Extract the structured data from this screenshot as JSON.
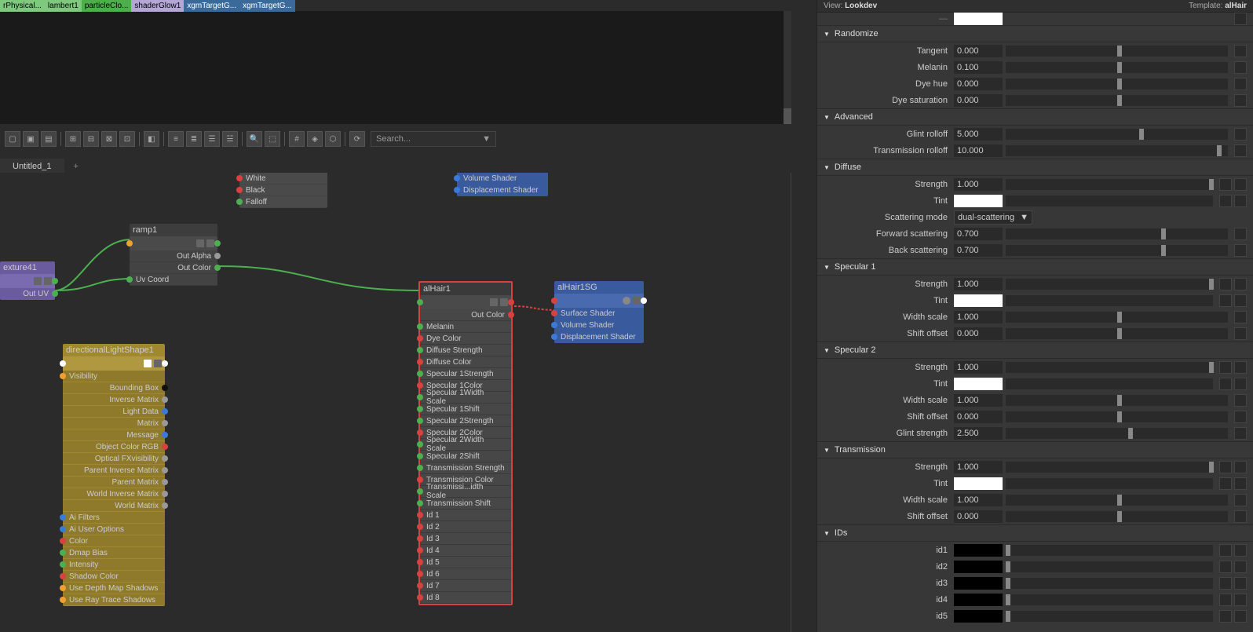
{
  "topTabs": [
    {
      "label": "rPhysical...",
      "cls": "tab-green-light"
    },
    {
      "label": "lambert1",
      "cls": "tab-green-light"
    },
    {
      "label": "particleClo...",
      "cls": "tab-green"
    },
    {
      "label": "shaderGlow1",
      "cls": "tab-purple"
    },
    {
      "label": "xgmTargetG...",
      "cls": "tab-dark"
    },
    {
      "label": "xgmTargetG...",
      "cls": "tab-dark"
    }
  ],
  "search": {
    "placeholder": "Search..."
  },
  "graphTab": "Untitled_1",
  "nodes": {
    "topRamp": {
      "rows": [
        "White",
        "Black",
        "Falloff"
      ]
    },
    "topShader": {
      "rows": [
        "Volume Shader",
        "Displacement Shader"
      ]
    },
    "ramp": {
      "title": "ramp1",
      "outAlpha": "Out Alpha",
      "outColor": "Out Color",
      "uvCoord": "Uv Coord"
    },
    "texture": {
      "title": "exture41",
      "outUV": "Out UV"
    },
    "light": {
      "title": "directionalLightShape1",
      "visibility": "Visibility",
      "rows": [
        "Bounding Box",
        "Inverse Matrix",
        "Light Data",
        "Matrix",
        "Message",
        "Object Color RGB",
        "Optical FXvisibility",
        "Parent Inverse Matrix",
        "Parent Matrix",
        "World Inverse Matrix",
        "World Matrix"
      ],
      "rows2": [
        "Ai Filters",
        "Ai User Options",
        "Color",
        "Dmap Bias",
        "Intensity",
        "Shadow Color",
        "Use Depth Map Shadows",
        "Use Ray Trace Shadows"
      ]
    },
    "alhair": {
      "title": "alHair1",
      "outColor": "Out Color",
      "rows": [
        "Melanin",
        "Dye Color",
        "Diffuse Strength",
        "Diffuse Color",
        "Specular 1Strength",
        "Specular 1Color",
        "Specular 1Width Scale",
        "Specular 1Shift",
        "Specular 2Strength",
        "Specular 2Color",
        "Specular 2Width Scale",
        "Specular 2Shift",
        "Transmission Strength",
        "Transmission Color",
        "Transmissi...idth Scale",
        "Transmission Shift",
        "Id 1",
        "Id 2",
        "Id 3",
        "Id 4",
        "Id 5",
        "Id 6",
        "Id 7",
        "Id 8"
      ]
    },
    "sg": {
      "title": "alHair1SG",
      "rows": [
        "Surface Shader",
        "Volume Shader",
        "Displacement Shader"
      ]
    }
  },
  "props": {
    "viewLabel": "View:",
    "view": "Lookdev",
    "templateLabel": "Template:",
    "template": "alHair",
    "sections": {
      "randomize": {
        "title": "Randomize",
        "rows": [
          {
            "label": "Tangent",
            "value": "0.000",
            "thumb": 50
          },
          {
            "label": "Melanin",
            "value": "0.100",
            "thumb": 50
          },
          {
            "label": "Dye hue",
            "value": "0.000",
            "thumb": 50
          },
          {
            "label": "Dye saturation",
            "value": "0.000",
            "thumb": 50
          }
        ]
      },
      "advanced": {
        "title": "Advanced",
        "rows": [
          {
            "label": "Glint rolloff",
            "value": "5.000",
            "thumb": 60
          },
          {
            "label": "Transmission rolloff",
            "value": "10.000",
            "thumb": 95
          }
        ]
      },
      "diffuse": {
        "title": "Diffuse",
        "rows": [
          {
            "label": "Strength",
            "value": "1.000",
            "thumb": 98,
            "twoicons": true
          },
          {
            "label": "Tint",
            "type": "color",
            "twoicons": true
          },
          {
            "label": "Scattering mode",
            "type": "select",
            "value": "dual-scattering"
          },
          {
            "label": "Forward scattering",
            "value": "0.700",
            "thumb": 70
          },
          {
            "label": "Back scattering",
            "value": "0.700",
            "thumb": 70
          }
        ]
      },
      "spec1": {
        "title": "Specular 1",
        "rows": [
          {
            "label": "Strength",
            "value": "1.000",
            "thumb": 98,
            "twoicons": true
          },
          {
            "label": "Tint",
            "type": "color",
            "twoicons": true
          },
          {
            "label": "Width scale",
            "value": "1.000",
            "thumb": 50
          },
          {
            "label": "Shift offset",
            "value": "0.000",
            "thumb": 50
          }
        ]
      },
      "spec2": {
        "title": "Specular 2",
        "rows": [
          {
            "label": "Strength",
            "value": "1.000",
            "thumb": 98,
            "twoicons": true
          },
          {
            "label": "Tint",
            "type": "color",
            "twoicons": true
          },
          {
            "label": "Width scale",
            "value": "1.000",
            "thumb": 50
          },
          {
            "label": "Shift offset",
            "value": "0.000",
            "thumb": 50
          },
          {
            "label": "Glint strength",
            "value": "2.500",
            "thumb": 55
          }
        ]
      },
      "transmission": {
        "title": "Transmission",
        "rows": [
          {
            "label": "Strength",
            "value": "1.000",
            "thumb": 98,
            "twoicons": true
          },
          {
            "label": "Tint",
            "type": "color",
            "twoicons": true
          },
          {
            "label": "Width scale",
            "value": "1.000",
            "thumb": 50
          },
          {
            "label": "Shift offset",
            "value": "0.000",
            "thumb": 50
          }
        ]
      },
      "ids": {
        "title": "IDs",
        "rows": [
          {
            "label": "id1",
            "type": "colorblack",
            "twoicons": true
          },
          {
            "label": "id2",
            "type": "colorblack",
            "twoicons": true
          },
          {
            "label": "id3",
            "type": "colorblack",
            "twoicons": true
          },
          {
            "label": "id4",
            "type": "colorblack",
            "twoicons": true
          },
          {
            "label": "id5",
            "type": "colorblack",
            "twoicons": true
          }
        ]
      }
    }
  }
}
